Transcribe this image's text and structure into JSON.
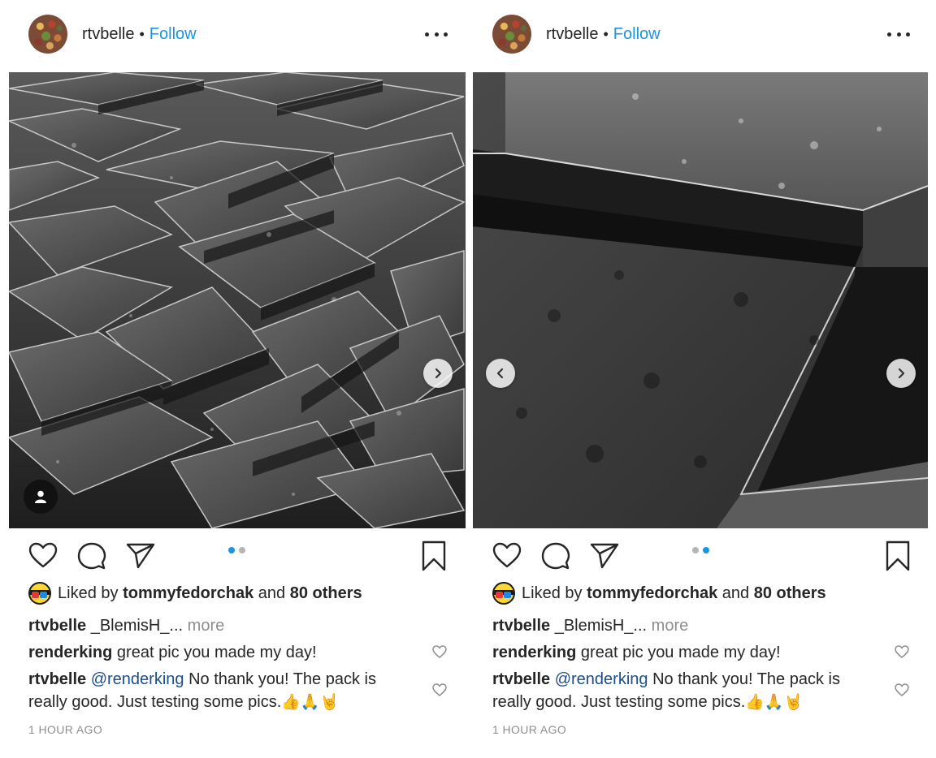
{
  "posts": [
    {
      "username": "rtvbelle",
      "separator": "•",
      "follow_label": "Follow",
      "likes_prefix": "Liked by",
      "liker": "tommyfedorchak",
      "likes_and": "and",
      "likes_count": "80 others",
      "caption_user": "rtvbelle",
      "caption_text": "_BlemisH_...",
      "caption_more": "more",
      "comments": [
        {
          "user": "renderking",
          "text": "great pic you made my day!"
        },
        {
          "user": "rtvbelle",
          "mention": "@renderking",
          "text": "No thank you! The pack is really good. Just testing some pics.",
          "emoji": "👍🙏🤘"
        }
      ],
      "time": "1 HOUR AGO",
      "carousel_index": 0
    },
    {
      "username": "rtvbelle",
      "separator": "•",
      "follow_label": "Follow",
      "likes_prefix": "Liked by",
      "liker": "tommyfedorchak",
      "likes_and": "and",
      "likes_count": "80 others",
      "caption_user": "rtvbelle",
      "caption_text": "_BlemisH_...",
      "caption_more": "more",
      "comments": [
        {
          "user": "renderking",
          "text": "great pic you made my day!"
        },
        {
          "user": "rtvbelle",
          "mention": "@renderking",
          "text": "No thank you! The pack is really good. Just testing some pics.",
          "emoji": "👍🙏🤘"
        }
      ],
      "time": "1 HOUR AGO",
      "carousel_index": 1
    }
  ],
  "icons": {
    "more": "more-options-icon",
    "like": "heart-icon",
    "comment": "comment-icon",
    "share": "paper-plane-icon",
    "save": "bookmark-icon",
    "next": "chevron-right-icon",
    "prev": "chevron-left-icon",
    "user_tag": "user-tag-icon",
    "comment_like": "small-heart-icon"
  },
  "colors": {
    "accent": "#1a95e0",
    "text": "#262626",
    "muted": "#8e8e8e",
    "mention": "#1c4e8a"
  }
}
